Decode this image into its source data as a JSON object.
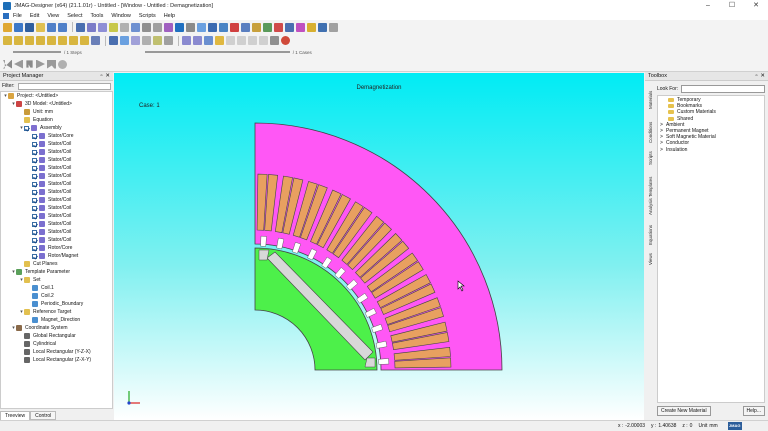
{
  "window": {
    "title": "JMAG-Designer (x64) (21.1.01r) - Untitled - [Window - Untitled : Demagnetization]",
    "minimize": "–",
    "maximize": "☐",
    "close": "✕"
  },
  "menu": [
    "File",
    "Edit",
    "View",
    "Select",
    "Tools",
    "Window",
    "Scripts",
    "Help"
  ],
  "step_bar": {
    "steps_label": "/ 1 Steps",
    "cases_label": "/ 1 Cases"
  },
  "project_manager": {
    "title": "Project Manager",
    "filter_label": "Filter:",
    "tree": [
      {
        "label": "Project: <Untitled>",
        "depth": 0,
        "expander": "▾",
        "icon": "project-icon",
        "color": "#d9a441",
        "check": false
      },
      {
        "label": "3D Model: <Untitled>",
        "depth": 1,
        "expander": "▾",
        "icon": "model-icon",
        "color": "#cc4444",
        "check": false
      },
      {
        "label": "Unit: mm",
        "depth": 2,
        "expander": "",
        "icon": "unit-icon",
        "color": "#c99b3a",
        "check": false
      },
      {
        "label": "Equation",
        "depth": 2,
        "expander": "",
        "icon": "equation-icon",
        "color": "#e2c04f",
        "check": false
      },
      {
        "label": "Assembly",
        "depth": 2,
        "expander": "▾",
        "icon": "assembly-icon",
        "color": "#7f6fd0",
        "check": true
      },
      {
        "label": "Stator/Core",
        "depth": 3,
        "expander": "",
        "icon": "part-icon",
        "color": "#7b6fcf",
        "check": true
      },
      {
        "label": "Stator/Coil",
        "depth": 3,
        "expander": "",
        "icon": "part-icon",
        "color": "#7b6fcf",
        "check": true
      },
      {
        "label": "Stator/Coil",
        "depth": 3,
        "expander": "",
        "icon": "part-icon",
        "color": "#7b6fcf",
        "check": true
      },
      {
        "label": "Stator/Coil",
        "depth": 3,
        "expander": "",
        "icon": "part-icon",
        "color": "#7b6fcf",
        "check": true
      },
      {
        "label": "Stator/Coil",
        "depth": 3,
        "expander": "",
        "icon": "part-icon",
        "color": "#7b6fcf",
        "check": true
      },
      {
        "label": "Stator/Coil",
        "depth": 3,
        "expander": "",
        "icon": "part-icon",
        "color": "#7b6fcf",
        "check": true
      },
      {
        "label": "Stator/Coil",
        "depth": 3,
        "expander": "",
        "icon": "part-icon",
        "color": "#7b6fcf",
        "check": true
      },
      {
        "label": "Stator/Coil",
        "depth": 3,
        "expander": "",
        "icon": "part-icon",
        "color": "#7b6fcf",
        "check": true
      },
      {
        "label": "Stator/Coil",
        "depth": 3,
        "expander": "",
        "icon": "part-icon",
        "color": "#7b6fcf",
        "check": true
      },
      {
        "label": "Stator/Coil",
        "depth": 3,
        "expander": "",
        "icon": "part-icon",
        "color": "#7b6fcf",
        "check": true
      },
      {
        "label": "Stator/Coil",
        "depth": 3,
        "expander": "",
        "icon": "part-icon",
        "color": "#7b6fcf",
        "check": true
      },
      {
        "label": "Stator/Coil",
        "depth": 3,
        "expander": "",
        "icon": "part-icon",
        "color": "#7b6fcf",
        "check": true
      },
      {
        "label": "Stator/Coil",
        "depth": 3,
        "expander": "",
        "icon": "part-icon",
        "color": "#7b6fcf",
        "check": true
      },
      {
        "label": "Stator/Coil",
        "depth": 3,
        "expander": "",
        "icon": "part-icon",
        "color": "#7b6fcf",
        "check": true
      },
      {
        "label": "Rotor/Core",
        "depth": 3,
        "expander": "",
        "icon": "part-icon",
        "color": "#7b6fcf",
        "check": true
      },
      {
        "label": "Rotor/Magnet",
        "depth": 3,
        "expander": "",
        "icon": "part-icon",
        "color": "#7b6fcf",
        "check": true
      },
      {
        "label": "Cut Planes",
        "depth": 2,
        "expander": "",
        "icon": "cutplane-icon",
        "color": "#e2c04f",
        "check": false
      },
      {
        "label": "Template Parameter",
        "depth": 1,
        "expander": "▾",
        "icon": "template-icon",
        "color": "#5aa05a",
        "check": false
      },
      {
        "label": "Set",
        "depth": 2,
        "expander": "▾",
        "icon": "set-icon",
        "color": "#e2c04f",
        "check": false
      },
      {
        "label": "Coil.1",
        "depth": 3,
        "expander": "",
        "icon": "coil-icon",
        "color": "#4a8fd0",
        "check": false
      },
      {
        "label": "Coil.2",
        "depth": 3,
        "expander": "",
        "icon": "coil-icon",
        "color": "#4a8fd0",
        "check": false
      },
      {
        "label": "Periodic_Boundary",
        "depth": 3,
        "expander": "",
        "icon": "boundary-icon",
        "color": "#4a8fd0",
        "check": false
      },
      {
        "label": "Reference Target",
        "depth": 2,
        "expander": "▾",
        "icon": "reference-icon",
        "color": "#e2c04f",
        "check": false
      },
      {
        "label": "Magnet_Direction",
        "depth": 3,
        "expander": "",
        "icon": "magnet-direction-icon",
        "color": "#4a8fd0",
        "check": false
      },
      {
        "label": "Coordinate System",
        "depth": 1,
        "expander": "▾",
        "icon": "coordinate-icon",
        "color": "#8a6a4a",
        "check": false
      },
      {
        "label": "Global Rectangular",
        "depth": 2,
        "expander": "",
        "icon": "axis-icon",
        "color": "#666666",
        "check": false
      },
      {
        "label": "Cylindrical",
        "depth": 2,
        "expander": "",
        "icon": "axis-icon",
        "color": "#666666",
        "check": false
      },
      {
        "label": "Local Rectangular (Y-Z-X)",
        "depth": 2,
        "expander": "",
        "icon": "axis-icon",
        "color": "#666666",
        "check": false
      },
      {
        "label": "Local Rectangular (Z-X-Y)",
        "depth": 2,
        "expander": "",
        "icon": "axis-icon",
        "color": "#666666",
        "check": false
      }
    ],
    "tabs": [
      "Treeview",
      "Control"
    ]
  },
  "viewport": {
    "title": "Demagnetization",
    "case_label": "Case: 1",
    "colors": {
      "stator_core": "#ff57f5",
      "coil": "#e8a060",
      "rotor_core": "#4df04a",
      "magnet": "#d8d8d8",
      "outline": "#444444"
    }
  },
  "toolbox": {
    "title": "Toolbox",
    "vertical_tabs": [
      "Materials",
      "Conditions",
      "Scripts",
      "Analysis Templates",
      "Equations",
      "Views"
    ],
    "look_for_label": "Look For:",
    "items": [
      {
        "label": "Temporary",
        "depth": 1,
        "expander": ""
      },
      {
        "label": "Bookmarks",
        "depth": 1,
        "expander": ""
      },
      {
        "label": "Custom Materials",
        "depth": 1,
        "expander": ""
      },
      {
        "label": "Shared",
        "depth": 1,
        "expander": ""
      },
      {
        "label": "Ambient",
        "depth": 0,
        "expander": ">"
      },
      {
        "label": "Permanent Magnet",
        "depth": 0,
        "expander": ">"
      },
      {
        "label": "Soft Magnetic Material",
        "depth": 0,
        "expander": ">"
      },
      {
        "label": "Conductor",
        "depth": 0,
        "expander": ">"
      },
      {
        "label": "Insulation",
        "depth": 0,
        "expander": ">"
      }
    ],
    "new_material_button": "Create New Material",
    "help_button": "Help..."
  },
  "status": {
    "x_label": "x :",
    "x_value": "-2.00003",
    "y_label": "y :",
    "y_value": "1.40638",
    "z_label": "z :",
    "z_value": "0",
    "unit_label": "Unit",
    "unit_value": "mm",
    "logo": "JMAG"
  },
  "toolbar_icons": {
    "row1": [
      "new-project-icon",
      "open-icon",
      "save-icon",
      "undo-icon",
      "redo-icon",
      "geometry-editor-icon",
      "import-icon",
      "mesh-icon",
      "run-icon",
      "select-icon",
      "rotate-icon",
      "zoom-icon",
      "fit-icon",
      "measure-icon"
    ],
    "row2": [
      "cube-icon",
      "sphere-icon",
      "cylinder-icon",
      "cone-icon",
      "torus-icon",
      "view-front-icon",
      "view-top-icon",
      "view-side-icon",
      "shading-icon",
      "wireframe-icon"
    ]
  }
}
